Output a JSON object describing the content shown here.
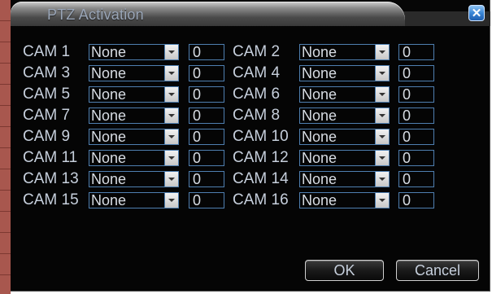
{
  "dialog": {
    "title": "PTZ Activation",
    "close_glyph": "✕"
  },
  "cameras": [
    {
      "label": "CAM 1",
      "option": "None",
      "value": "0"
    },
    {
      "label": "CAM 2",
      "option": "None",
      "value": "0"
    },
    {
      "label": "CAM 3",
      "option": "None",
      "value": "0"
    },
    {
      "label": "CAM 4",
      "option": "None",
      "value": "0"
    },
    {
      "label": "CAM 5",
      "option": "None",
      "value": "0"
    },
    {
      "label": "CAM 6",
      "option": "None",
      "value": "0"
    },
    {
      "label": "CAM 7",
      "option": "None",
      "value": "0"
    },
    {
      "label": "CAM 8",
      "option": "None",
      "value": "0"
    },
    {
      "label": "CAM 9",
      "option": "None",
      "value": "0"
    },
    {
      "label": "CAM 10",
      "option": "None",
      "value": "0"
    },
    {
      "label": "CAM 11",
      "option": "None",
      "value": "0"
    },
    {
      "label": "CAM 12",
      "option": "None",
      "value": "0"
    },
    {
      "label": "CAM 13",
      "option": "None",
      "value": "0"
    },
    {
      "label": "CAM 14",
      "option": "None",
      "value": "0"
    },
    {
      "label": "CAM 15",
      "option": "None",
      "value": "0"
    },
    {
      "label": "CAM 16",
      "option": "None",
      "value": "0"
    }
  ],
  "buttons": {
    "ok": "OK",
    "cancel": "Cancel"
  },
  "colors": {
    "accent": "#4f7fb0",
    "text": "#c6cfdc",
    "background": "#050505"
  }
}
